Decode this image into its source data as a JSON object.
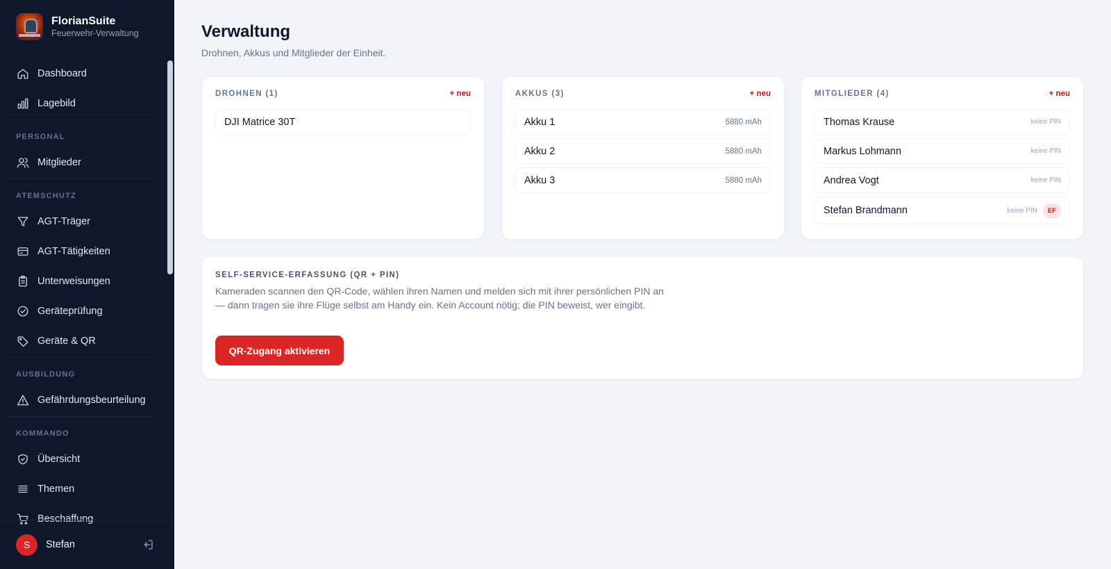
{
  "brand": {
    "name": "FlorianSuite",
    "subtitle": "Feuerwehr-Verwaltung"
  },
  "nav": {
    "items_top": [
      {
        "label": "Dashboard",
        "icon": "home-icon"
      },
      {
        "label": "Lagebild",
        "icon": "bar-chart-icon"
      }
    ],
    "sections": [
      {
        "title": "PERSONAL",
        "items": [
          {
            "label": "Mitglieder",
            "icon": "users-icon"
          }
        ]
      },
      {
        "title": "ATEMSCHUTZ",
        "items": [
          {
            "label": "AGT-Träger",
            "icon": "filter-icon"
          },
          {
            "label": "AGT-Tätigkeiten",
            "icon": "card-icon"
          },
          {
            "label": "Unterweisungen",
            "icon": "clipboard-icon"
          },
          {
            "label": "Geräteprüfung",
            "icon": "check-circle-icon"
          },
          {
            "label": "Geräte & QR",
            "icon": "tag-icon"
          }
        ]
      },
      {
        "title": "AUSBILDUNG",
        "items": [
          {
            "label": "Gefährdungsbeurteilung",
            "icon": "warning-icon"
          }
        ]
      },
      {
        "title": "KOMMANDO",
        "items": [
          {
            "label": "Übersicht",
            "icon": "shield-check-icon"
          },
          {
            "label": "Themen",
            "icon": "list-icon"
          },
          {
            "label": "Beschaffung",
            "icon": "cart-icon"
          }
        ]
      }
    ]
  },
  "user": {
    "initial": "S",
    "name": "Stefan"
  },
  "page": {
    "title": "Verwaltung",
    "subtitle": "Drohnen, Akkus und Mitglieder der Einheit."
  },
  "cards": {
    "drones": {
      "title": "DROHNEN (1)",
      "add": "+ neu",
      "items": [
        {
          "name": "DJI Matrice 30T"
        }
      ]
    },
    "batteries": {
      "title": "AKKUS (3)",
      "add": "+ neu",
      "items": [
        {
          "name": "Akku 1",
          "meta": "5880 mAh"
        },
        {
          "name": "Akku 2",
          "meta": "5880 mAh"
        },
        {
          "name": "Akku 3",
          "meta": "5880 mAh"
        }
      ]
    },
    "members": {
      "title": "MITGLIEDER (4)",
      "add": "+ neu",
      "items": [
        {
          "name": "Thomas Krause",
          "pin": "keine PIN"
        },
        {
          "name": "Markus Lohmann",
          "pin": "keine PIN"
        },
        {
          "name": "Andrea Vogt",
          "pin": "keine PIN"
        },
        {
          "name": "Stefan Brandmann",
          "pin": "keine PIN",
          "badge": "EF"
        }
      ]
    }
  },
  "self_service": {
    "title": "SELF-SERVICE-ERFASSUNG (QR + PIN)",
    "text": "Kameraden scannen den QR-Code, wählen ihren Namen und melden sich mit ihrer persönlichen PIN an — dann tragen sie ihre Flüge selbst am Handy ein. Kein Account nötig; die PIN beweist, wer eingibt.",
    "button": "QR-Zugang aktivieren"
  },
  "colors": {
    "sidebar_bg": "#0f172a",
    "accent": "#dc2626",
    "page_bg": "#f1f4f8"
  }
}
